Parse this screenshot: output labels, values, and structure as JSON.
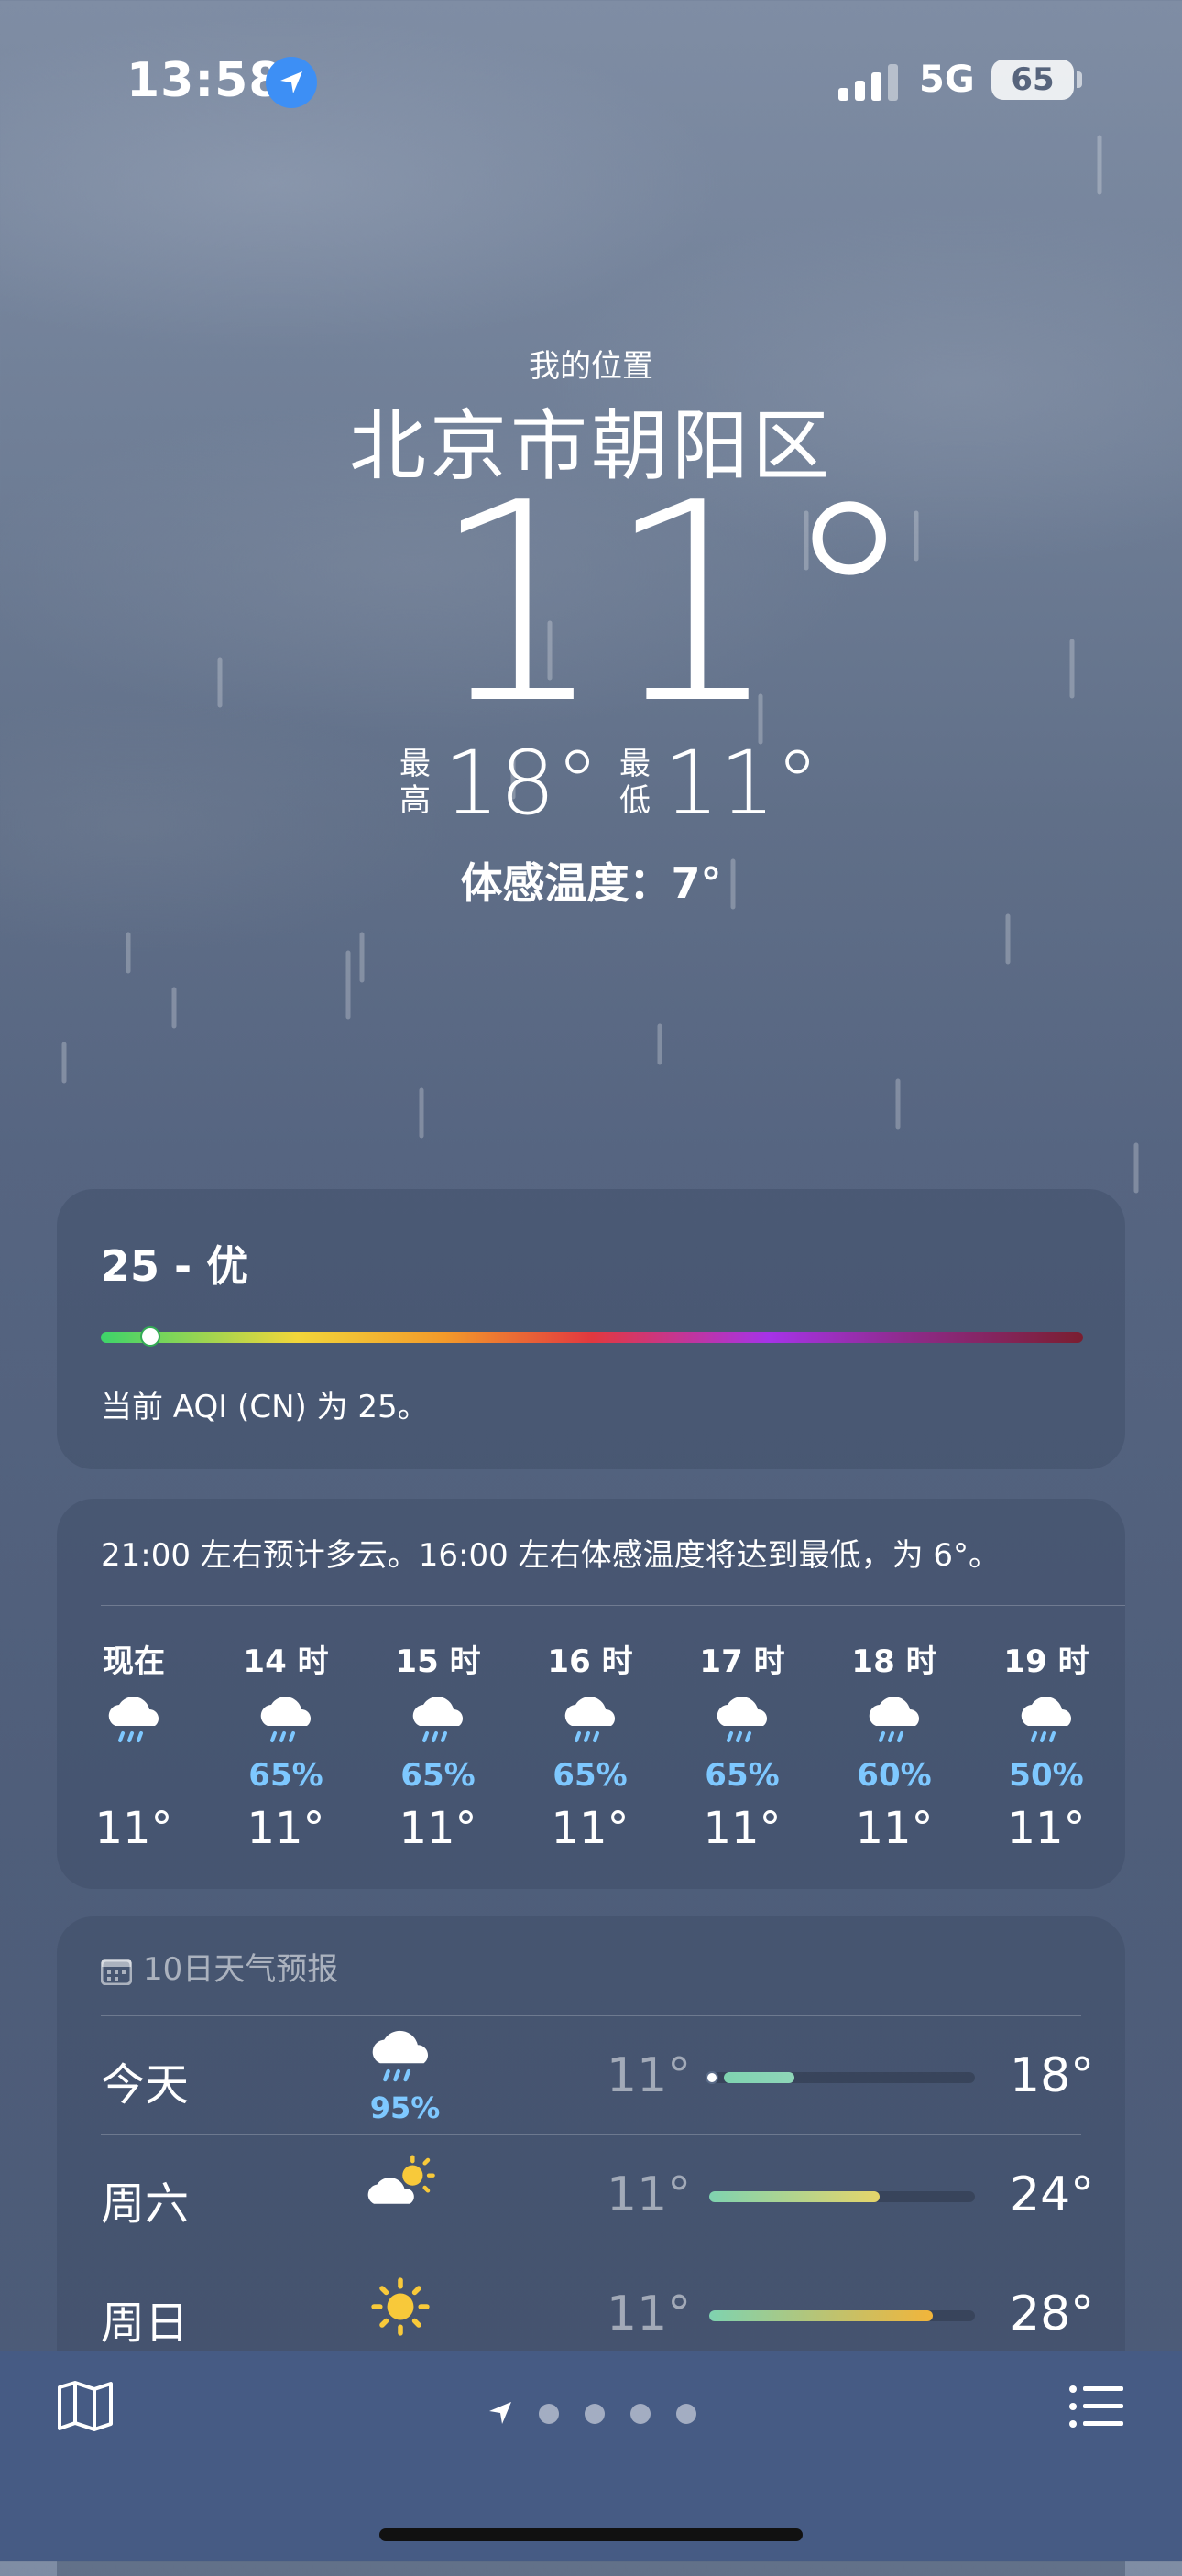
{
  "status_bar": {
    "time": "13:58",
    "network": "5G",
    "battery": "65",
    "icons": [
      "location-arrow-icon",
      "signal-icon",
      "battery-icon"
    ]
  },
  "header": {
    "my_location": "我的位置",
    "city": "北京市朝阳区",
    "temperature": "11°",
    "high_label": "最高",
    "high": "18°",
    "low_label": "最低",
    "low": "11°",
    "feels_like": "体感温度：7°"
  },
  "aqi": {
    "value_text": "25 - 优",
    "level_fraction": 0.05,
    "description": "当前 AQI (CN) 为 25。"
  },
  "hourly": {
    "summary": "21:00 左右预计多云。16:00 左右体感温度将达到最低，为 6°。",
    "hours": [
      {
        "label": "现在",
        "icon": "rain-cloud-icon",
        "pct": "",
        "temp": "11°"
      },
      {
        "label": "14 时",
        "icon": "rain-cloud-icon",
        "pct": "65%",
        "temp": "11°"
      },
      {
        "label": "15 时",
        "icon": "rain-cloud-icon",
        "pct": "65%",
        "temp": "11°"
      },
      {
        "label": "16 时",
        "icon": "rain-cloud-icon",
        "pct": "65%",
        "temp": "11°"
      },
      {
        "label": "17 时",
        "icon": "rain-cloud-icon",
        "pct": "65%",
        "temp": "11°"
      },
      {
        "label": "18 时",
        "icon": "rain-cloud-icon",
        "pct": "60%",
        "temp": "11°"
      },
      {
        "label": "19 时",
        "icon": "rain-cloud-icon",
        "pct": "50%",
        "temp": "11°"
      }
    ]
  },
  "ten_day": {
    "title": "10日天气预报",
    "days": [
      {
        "day": "今天",
        "icon": "rain-cloud-icon",
        "pct": "95%",
        "low": "11°",
        "high": "18°",
        "fill_from": 0.0,
        "fill_to": 0.32,
        "colors": [
          "#7fd3b0",
          "#8fd6b8"
        ],
        "current": true
      },
      {
        "day": "周六",
        "icon": "partly-sunny-icon",
        "pct": "",
        "low": "11°",
        "high": "24°",
        "fill_from": 0.0,
        "fill_to": 0.64,
        "colors": [
          "#7fd3b0",
          "#e6d56a"
        ],
        "current": false
      },
      {
        "day": "周日",
        "icon": "sun-icon",
        "pct": "",
        "low": "11°",
        "high": "28°",
        "fill_from": 0.0,
        "fill_to": 0.84,
        "colors": [
          "#7fd3b0",
          "#f2b53a"
        ],
        "current": false
      }
    ]
  },
  "bottom_bar": {
    "icons": [
      "map-icon",
      "location-arrow-icon",
      "page-dot",
      "page-dot",
      "page-dot",
      "page-dot",
      "list-icon"
    ]
  }
}
